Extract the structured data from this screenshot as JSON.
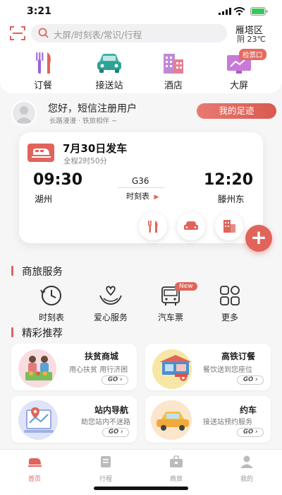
{
  "status_bar": {
    "time": "3:21"
  },
  "header": {
    "search_placeholder": "大屏/时刻表/常识/行程",
    "location": "雁塔区",
    "weather": "阴 23℃",
    "quick_links": [
      {
        "label": "订餐",
        "icon": "fork-knife-icon"
      },
      {
        "label": "接送站",
        "icon": "car-icon"
      },
      {
        "label": "酒店",
        "icon": "hotel-icon"
      },
      {
        "label": "大屏",
        "icon": "screen-icon",
        "badge": "检票口"
      }
    ]
  },
  "user": {
    "greeting": "您好，短信注册用户",
    "slogan": "长路漫漫 · 铁旅相伴 ~",
    "footprint_button": "我的足迹"
  },
  "trip": {
    "date_title": "7月30日发车",
    "duration": "全程2时50分",
    "depart_time": "09:30",
    "depart_station": "湖州",
    "arrive_time": "12:20",
    "arrive_station": "滕州东",
    "train_no": "G36",
    "schedule_link": "时刻表",
    "actions": [
      "fork-knife-icon",
      "car-icon",
      "hotel-icon"
    ]
  },
  "business_section": {
    "title": "商旅服务",
    "items": [
      {
        "label": "时刻表",
        "icon": "clock-icon"
      },
      {
        "label": "爱心服务",
        "icon": "heart-hands-icon"
      },
      {
        "label": "汽车票",
        "icon": "bus-icon",
        "badge": "New"
      },
      {
        "label": "更多",
        "icon": "grid-icon"
      }
    ]
  },
  "recommend_section": {
    "title": "精彩推荐",
    "cards": [
      {
        "title": "扶贫商城",
        "subtitle": "用心扶贫 用行济困",
        "go": "GO"
      },
      {
        "title": "高铁订餐",
        "subtitle": "餐饮送到您座位",
        "go": "GO"
      },
      {
        "title": "站内导航",
        "subtitle": "助您站内不迷路",
        "go": "GO"
      },
      {
        "title": "约车",
        "subtitle": "接送站预约服务",
        "go": "GO"
      }
    ]
  },
  "bottom_nav": [
    {
      "label": "首页",
      "active": true
    },
    {
      "label": "行程",
      "active": false
    },
    {
      "label": "商旅",
      "active": false
    },
    {
      "label": "我的",
      "active": false
    }
  ],
  "colors": {
    "accent": "#e0645a",
    "background": "#f6f6f7"
  }
}
